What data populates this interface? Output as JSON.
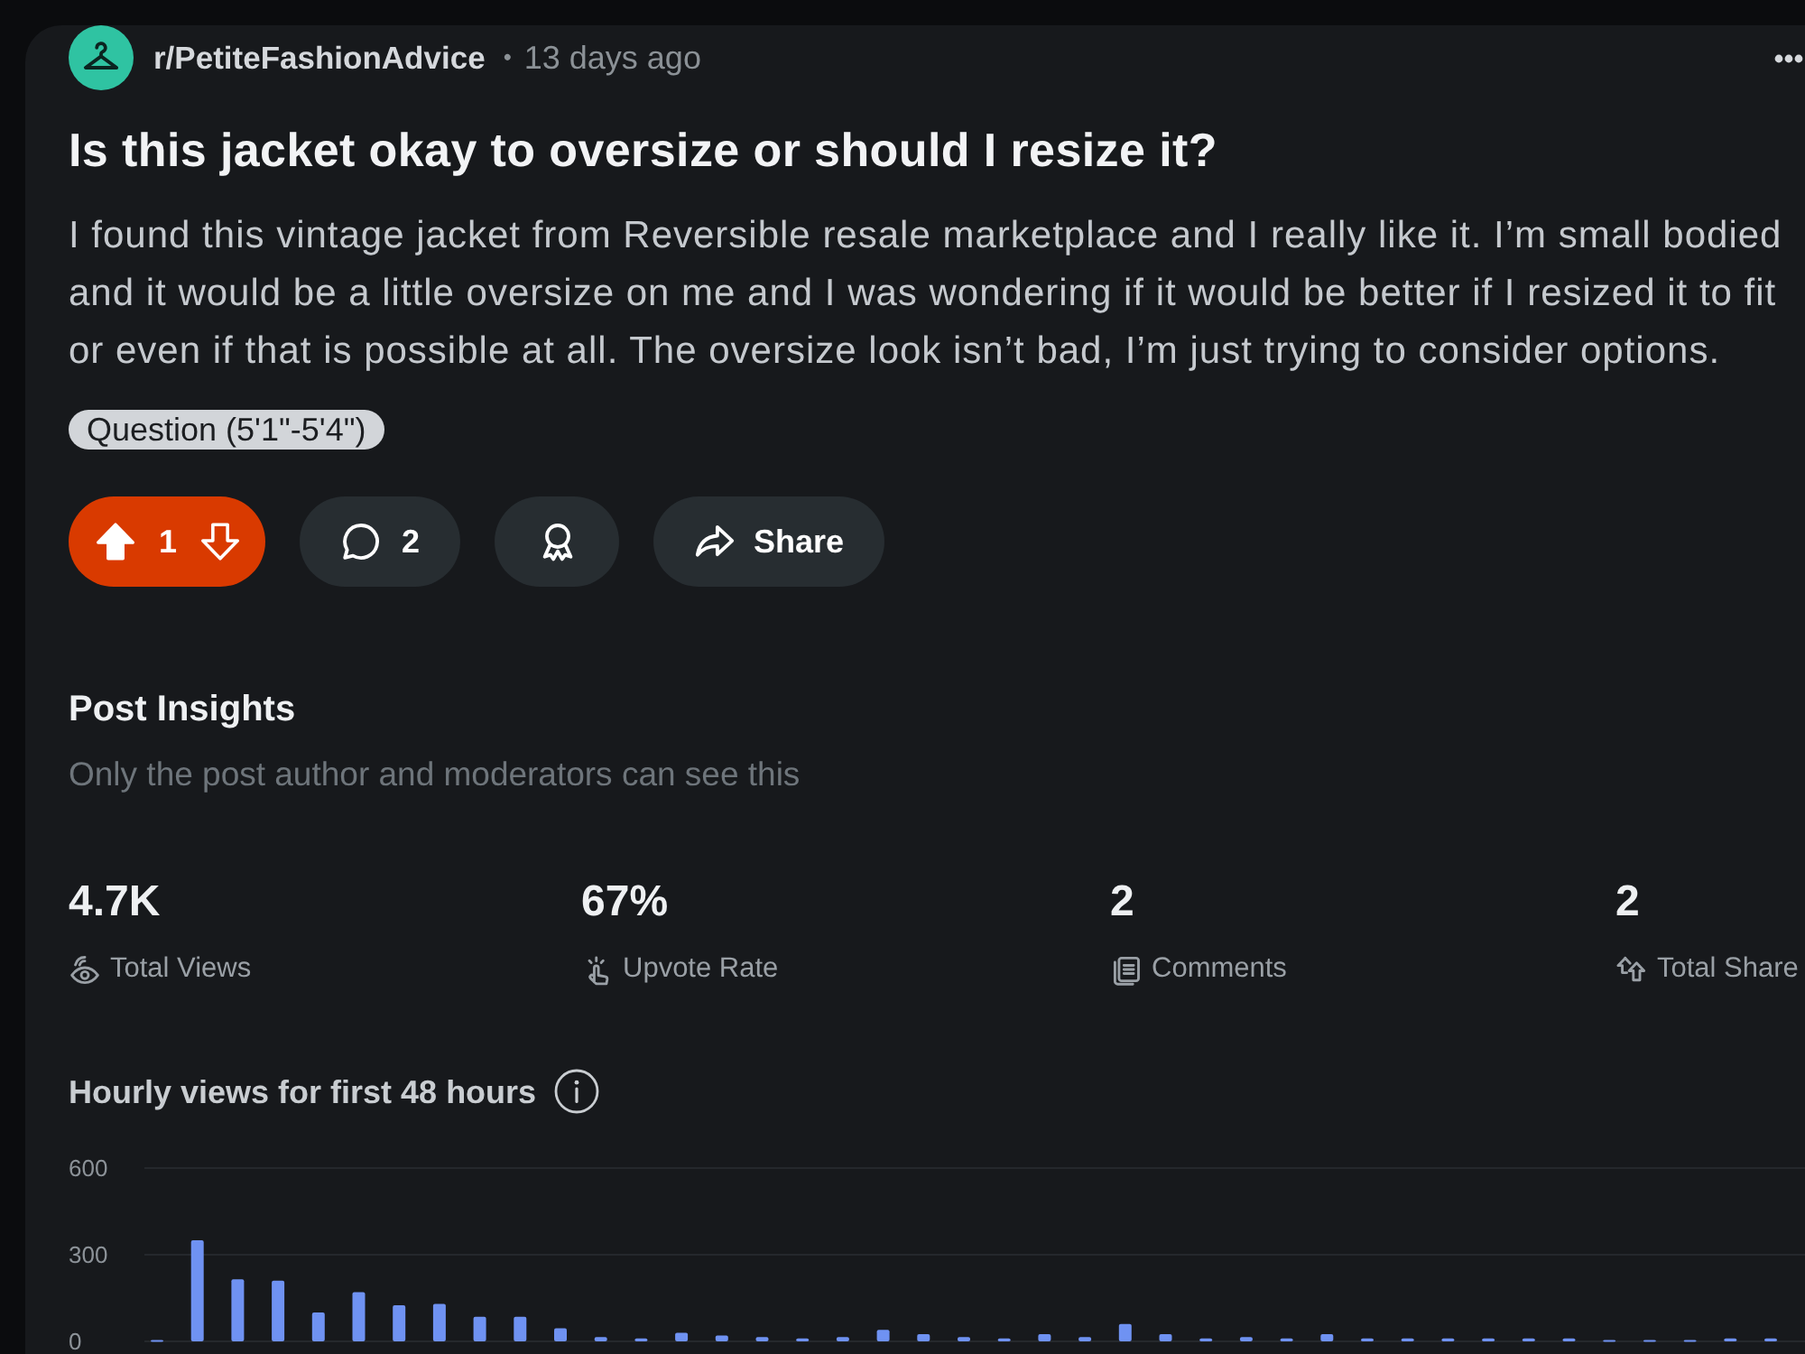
{
  "post": {
    "subreddit": "r/PetiteFashionAdvice",
    "separator": "•",
    "time": "13 days ago",
    "title": "Is this jacket okay to oversize or should I resize it?",
    "body": "I found this vintage jacket from Reversible resale marketplace and I really like it. I’m small bodied and it would be a little oversize on me and I was wondering if it would be better if I resized it to fit or even if that is possible at all. The oversize look isn’t bad, I’m just trying to consider options.",
    "flair": "Question (5'1\"-5'4\")"
  },
  "actions": {
    "vote": {
      "upvoted": true,
      "count": "1"
    },
    "comments": {
      "count": "2"
    },
    "share": {
      "label": "Share"
    }
  },
  "insights": {
    "title": "Post Insights",
    "subtitle": "Only the post author and moderators can see this",
    "stats": [
      {
        "kind": "views",
        "value": "4.7K",
        "label": "Total Views"
      },
      {
        "kind": "upvote_rate",
        "value": "67%",
        "label": "Upvote Rate"
      },
      {
        "kind": "comments",
        "value": "2",
        "label": "Comments"
      },
      {
        "kind": "shares",
        "value": "2",
        "label": "Total Share"
      }
    ]
  },
  "chart": {
    "chart_data": {
      "type": "bar",
      "title": "Hourly views for first 48 hours",
      "values": [
        5,
        350,
        215,
        210,
        100,
        170,
        125,
        130,
        85,
        85,
        45,
        15,
        10,
        30,
        20,
        15,
        10,
        15,
        40,
        25,
        15,
        10,
        25,
        15,
        60,
        25,
        10,
        15,
        10,
        25,
        10,
        10,
        10,
        10,
        10,
        10,
        5,
        5,
        5,
        10,
        10
      ],
      "ylim": [
        0,
        600
      ],
      "yticks": [
        0,
        300,
        600
      ]
    }
  }
}
